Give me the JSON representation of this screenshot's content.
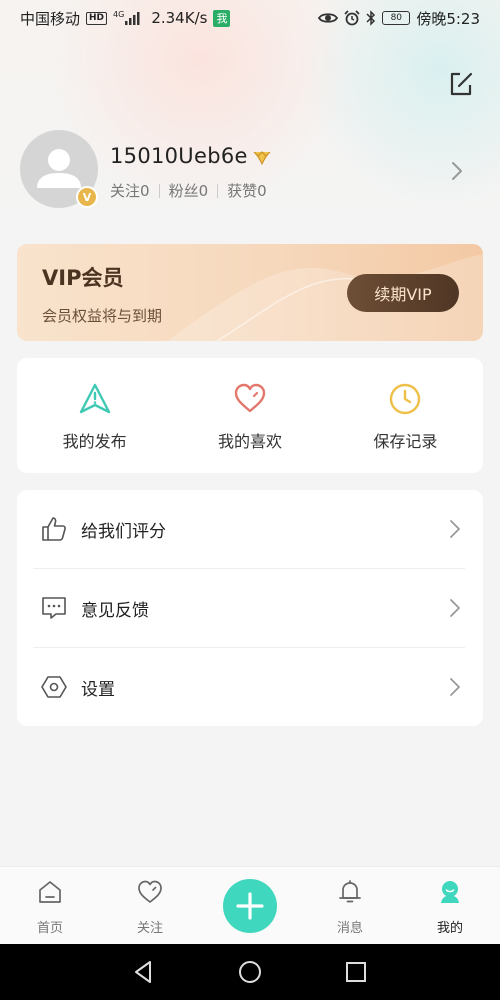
{
  "status_bar": {
    "carrier": "中国移动",
    "hd_badge": "HD",
    "network": "4G",
    "speed": "2.34K/s",
    "app_badge": "我",
    "battery": "80",
    "time": "傍晚5:23"
  },
  "profile": {
    "username": "15010Ueb6e",
    "verify_badge": "V",
    "stats": [
      {
        "label": "关注",
        "value": "0"
      },
      {
        "label": "粉丝",
        "value": "0"
      },
      {
        "label": "获赞",
        "value": "0"
      }
    ]
  },
  "vip": {
    "title": "VIP会员",
    "subtitle": "会员权益将与到期",
    "button_label": "续期VIP"
  },
  "quick_actions": [
    {
      "label": "我的发布",
      "icon": "paper-plane-icon",
      "color": "#3ec9b4"
    },
    {
      "label": "我的喜欢",
      "icon": "heart-icon",
      "color": "#e4776b"
    },
    {
      "label": "保存记录",
      "icon": "clock-icon",
      "color": "#eec04a"
    }
  ],
  "menu": [
    {
      "label": "给我们评分",
      "icon": "thumbs-up-icon"
    },
    {
      "label": "意见反馈",
      "icon": "feedback-icon"
    },
    {
      "label": "设置",
      "icon": "settings-icon"
    }
  ],
  "tabs": [
    {
      "label": "首页",
      "icon": "home-icon",
      "active": false
    },
    {
      "label": "关注",
      "icon": "heart-icon",
      "active": false
    },
    {
      "label": "",
      "icon": "plus-icon",
      "active": false
    },
    {
      "label": "消息",
      "icon": "bell-icon",
      "active": false
    },
    {
      "label": "我的",
      "icon": "profile-icon",
      "active": true
    }
  ],
  "colors": {
    "accent": "#3fd7bd",
    "vip_button": "#5a3e2a",
    "vip_gold": "#e8b64a"
  }
}
